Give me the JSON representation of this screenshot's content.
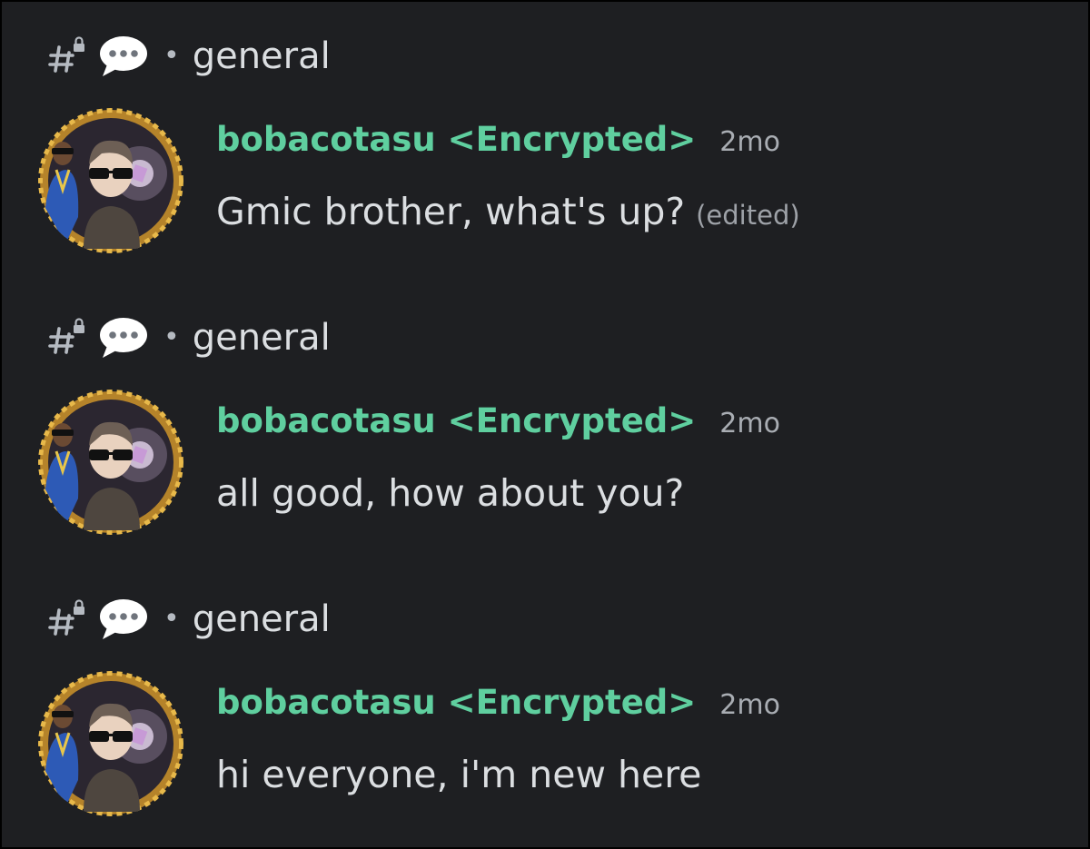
{
  "messages": [
    {
      "channel_icon": "locked-hash-icon",
      "thread_icon": "speech-bubble-icon",
      "separator": "•",
      "channel": "general",
      "username": "bobacotasu",
      "tag": "<Encrypted>",
      "timestamp": "2mo",
      "text": "Gmic brother, what's up?",
      "edited": "(edited)"
    },
    {
      "channel_icon": "locked-hash-icon",
      "thread_icon": "speech-bubble-icon",
      "separator": "•",
      "channel": "general",
      "username": "bobacotasu",
      "tag": "<Encrypted>",
      "timestamp": "2mo",
      "text": "all good, how about you?",
      "edited": ""
    },
    {
      "channel_icon": "locked-hash-icon",
      "thread_icon": "speech-bubble-icon",
      "separator": "•",
      "channel": "general",
      "username": "bobacotasu",
      "tag": "<Encrypted>",
      "timestamp": "2mo",
      "text": "hi everyone, i'm new here",
      "edited": ""
    }
  ],
  "colors": {
    "background": "#1e1f22",
    "username": "#5fcf9f",
    "text": "#dbdee1",
    "muted": "#a9adb3",
    "avatar_ring": "#c8912c"
  }
}
